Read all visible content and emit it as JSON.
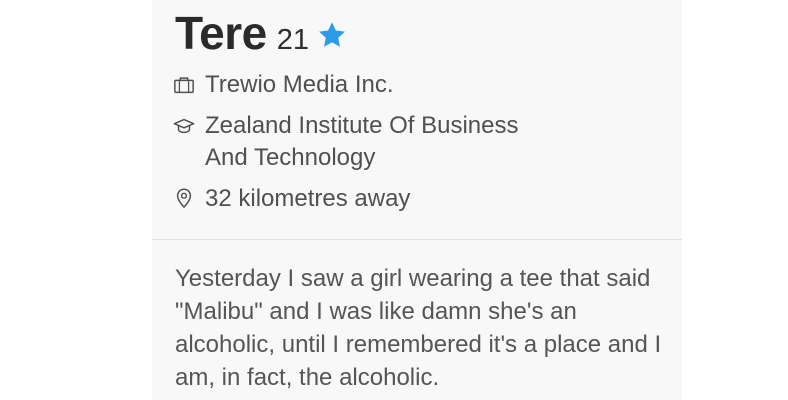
{
  "profile": {
    "name": "Tere",
    "age": "21",
    "job": "Trewio Media Inc.",
    "school_line1": "Zealand Institute Of Business",
    "school_line2": "And Technology",
    "distance": "32 kilometres away",
    "bio": "Yesterday I saw a girl wearing a tee that said \"Malibu\" and I was like damn she's an alcoholic, until I remembered it's a place and I am, in fact, the alcoholic."
  },
  "icons": {
    "verified": "star-icon",
    "job": "briefcase-icon",
    "school": "graduation-cap-icon",
    "distance": "location-pin-icon"
  },
  "colors": {
    "verified_star": "#2d9be8",
    "name_text": "#2a2a2a",
    "info_text": "#505050"
  }
}
